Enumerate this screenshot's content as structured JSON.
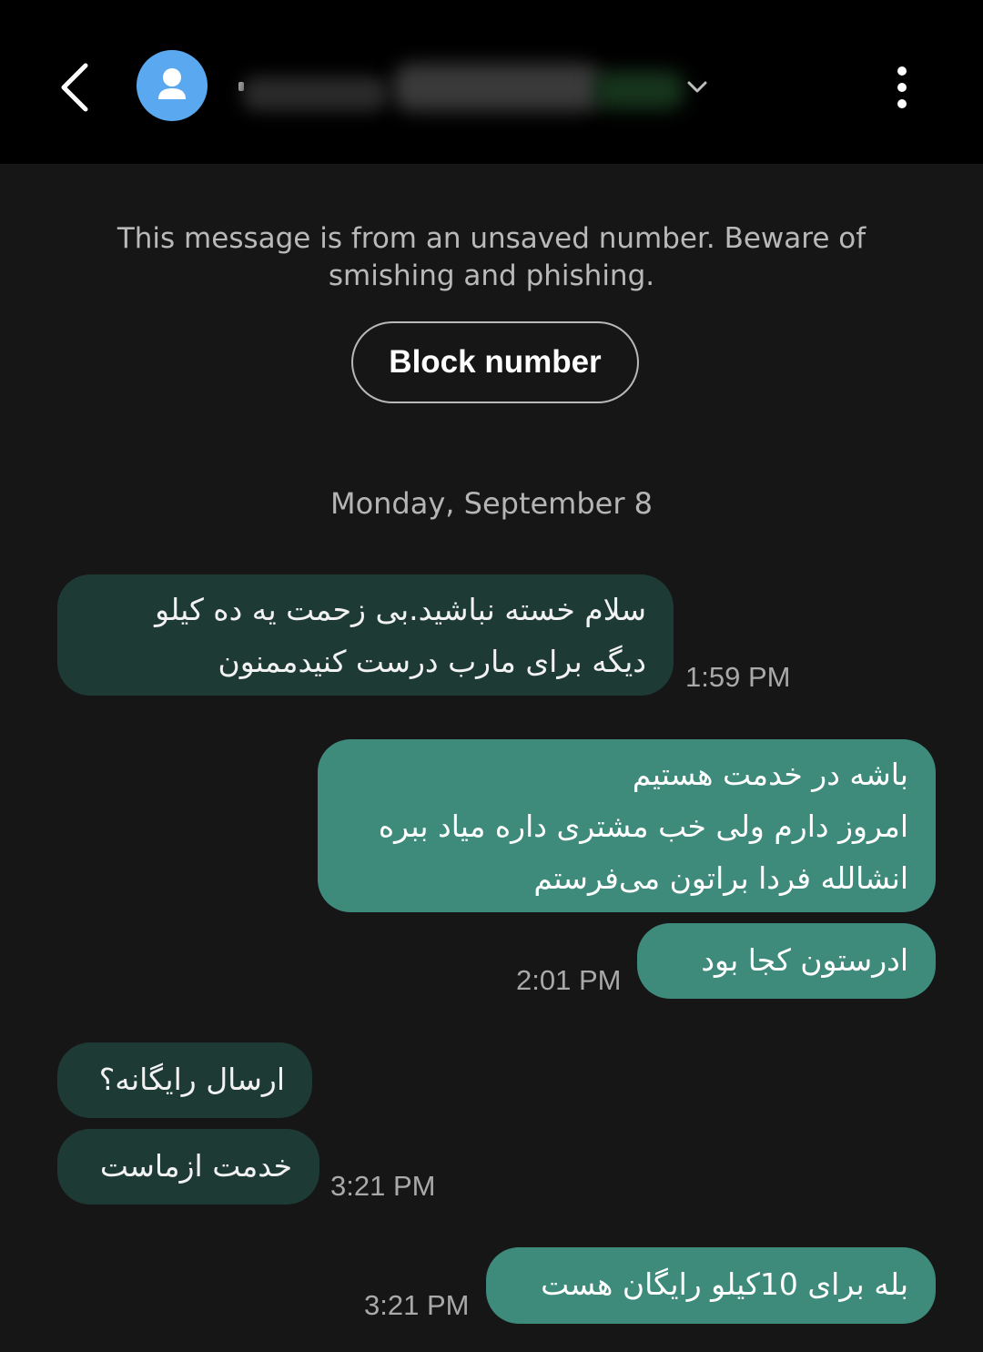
{
  "header": {
    "contact_name": "",
    "icons": {
      "back": "chevron-left-icon",
      "avatar": "person-icon",
      "expand": "chevron-down-icon",
      "more": "more-vertical-icon"
    }
  },
  "notice": {
    "text": "This message is from an unsaved number. Beware of smishing and phishing.",
    "block_button": "Block number"
  },
  "date_separator": "Monday, September 8",
  "messages": [
    {
      "direction": "incoming",
      "text": "سلام خسته نباشید.بی زحمت یه ده کیلو\nدیگه برای مارب درست کنیدممنون",
      "time": "1:59 PM"
    },
    {
      "direction": "outgoing",
      "text": "باشه در خدمت هستیم\nامروز دارم ولی خب مشتری داره میاد ببره\nانشالله فردا براتون می‌فرستم",
      "time": ""
    },
    {
      "direction": "outgoing",
      "text": "ادرستون کجا بود",
      "time": "2:01 PM"
    },
    {
      "direction": "incoming",
      "text": "ارسال رایگانه؟",
      "time": ""
    },
    {
      "direction": "incoming",
      "text": "خدمت ازماست",
      "time": "3:21 PM"
    },
    {
      "direction": "outgoing",
      "text": "بله برای 10کیلو رایگان هست",
      "time": "3:21 PM"
    }
  ],
  "colors": {
    "background": "#161616",
    "header": "#000000",
    "incoming_bubble": "#1e3a34",
    "outgoing_bubble": "#3e8a7b",
    "avatar": "#5aa9f0"
  }
}
